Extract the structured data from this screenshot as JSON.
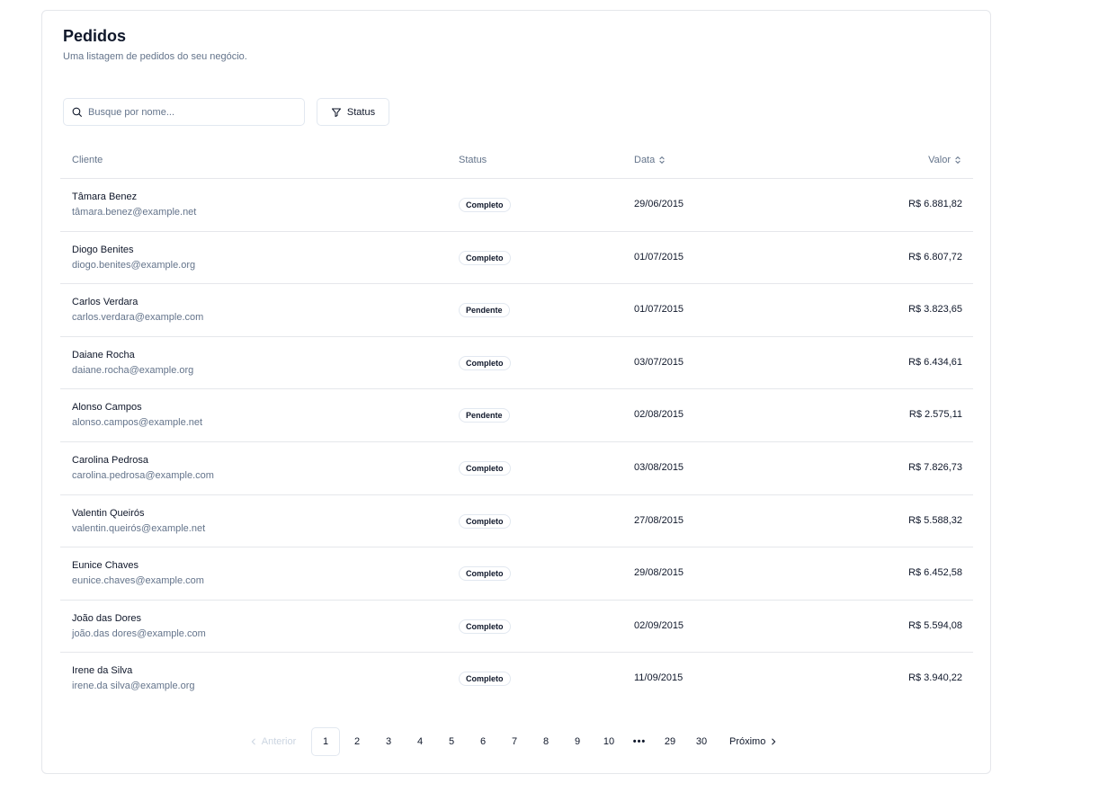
{
  "header": {
    "title": "Pedidos",
    "subtitle": "Uma listagem de pedidos do seu negócio."
  },
  "search": {
    "placeholder": "Busque por nome...",
    "value": ""
  },
  "filter": {
    "label": "Status"
  },
  "table": {
    "columns": {
      "client": "Cliente",
      "status": "Status",
      "date": "Data",
      "value": "Valor"
    },
    "rows": [
      {
        "name": "Tâmara Benez",
        "email": "tâmara.benez@example.net",
        "status": "Completo",
        "date": "29/06/2015",
        "value": "R$ 6.881,82"
      },
      {
        "name": "Diogo Benites",
        "email": "diogo.benites@example.org",
        "status": "Completo",
        "date": "01/07/2015",
        "value": "R$ 6.807,72"
      },
      {
        "name": "Carlos Verdara",
        "email": "carlos.verdara@example.com",
        "status": "Pendente",
        "date": "01/07/2015",
        "value": "R$ 3.823,65"
      },
      {
        "name": "Daiane Rocha",
        "email": "daiane.rocha@example.org",
        "status": "Completo",
        "date": "03/07/2015",
        "value": "R$ 6.434,61"
      },
      {
        "name": "Alonso Campos",
        "email": "alonso.campos@example.net",
        "status": "Pendente",
        "date": "02/08/2015",
        "value": "R$ 2.575,11"
      },
      {
        "name": "Carolina Pedrosa",
        "email": "carolina.pedrosa@example.com",
        "status": "Completo",
        "date": "03/08/2015",
        "value": "R$ 7.826,73"
      },
      {
        "name": "Valentin Queirós",
        "email": "valentin.queirós@example.net",
        "status": "Completo",
        "date": "27/08/2015",
        "value": "R$ 5.588,32"
      },
      {
        "name": "Eunice Chaves",
        "email": "eunice.chaves@example.com",
        "status": "Completo",
        "date": "29/08/2015",
        "value": "R$ 6.452,58"
      },
      {
        "name": "João das Dores",
        "email": "joão.das dores@example.com",
        "status": "Completo",
        "date": "02/09/2015",
        "value": "R$ 5.594,08"
      },
      {
        "name": "Irene da Silva",
        "email": "irene.da silva@example.org",
        "status": "Completo",
        "date": "11/09/2015",
        "value": "R$ 3.940,22"
      }
    ]
  },
  "pagination": {
    "prev": "Anterior",
    "next": "Próximo",
    "ellipsis": "•••",
    "pages": [
      "1",
      "2",
      "3",
      "4",
      "5",
      "6",
      "7",
      "8",
      "9",
      "10"
    ],
    "last_pages": [
      "29",
      "30"
    ],
    "current": "1"
  },
  "icons": {
    "search": "search-icon",
    "filter": "filter-icon",
    "sort": "sort-icon",
    "chevron_left": "chevron-left-icon",
    "chevron_right": "chevron-right-icon"
  }
}
